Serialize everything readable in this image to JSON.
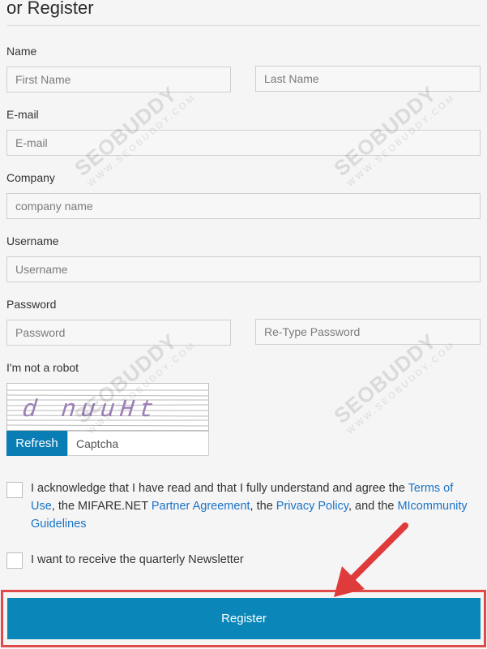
{
  "header": {
    "title": "or Register"
  },
  "form": {
    "name_label": "Name",
    "first_name_placeholder": "First Name",
    "last_name_placeholder": "Last Name",
    "email_label": "E-mail",
    "email_placeholder": "E-mail",
    "company_label": "Company",
    "company_placeholder": "company name",
    "username_label": "Username",
    "username_placeholder": "Username",
    "password_label": "Password",
    "password_placeholder": "Password",
    "retype_password_placeholder": "Re-Type Password",
    "robot_label": "I'm not a robot"
  },
  "captcha": {
    "image_text": "d nuuHt",
    "refresh_label": "Refresh",
    "input_placeholder": "Captcha"
  },
  "agreement": {
    "text_1": "I acknowledge that I have read and that I fully understand and agree the ",
    "terms_link": "Terms of Use",
    "text_2": ", the MIFARE.NET ",
    "partner_link": "Partner Agreement",
    "text_3": ", the ",
    "privacy_link": "Privacy Policy",
    "text_4": ", and the ",
    "guidelines_link": "MIcommunity Guidelines"
  },
  "newsletter": {
    "label": "I want to receive the quarterly Newsletter"
  },
  "register": {
    "label": "Register"
  },
  "watermark": {
    "brand": "SEOBUDDY",
    "url": "WWW.SEOBUDDY.COM"
  },
  "colors": {
    "accent": "#0a86b8",
    "link": "#1a73c8",
    "highlight": "#e04a4a"
  }
}
